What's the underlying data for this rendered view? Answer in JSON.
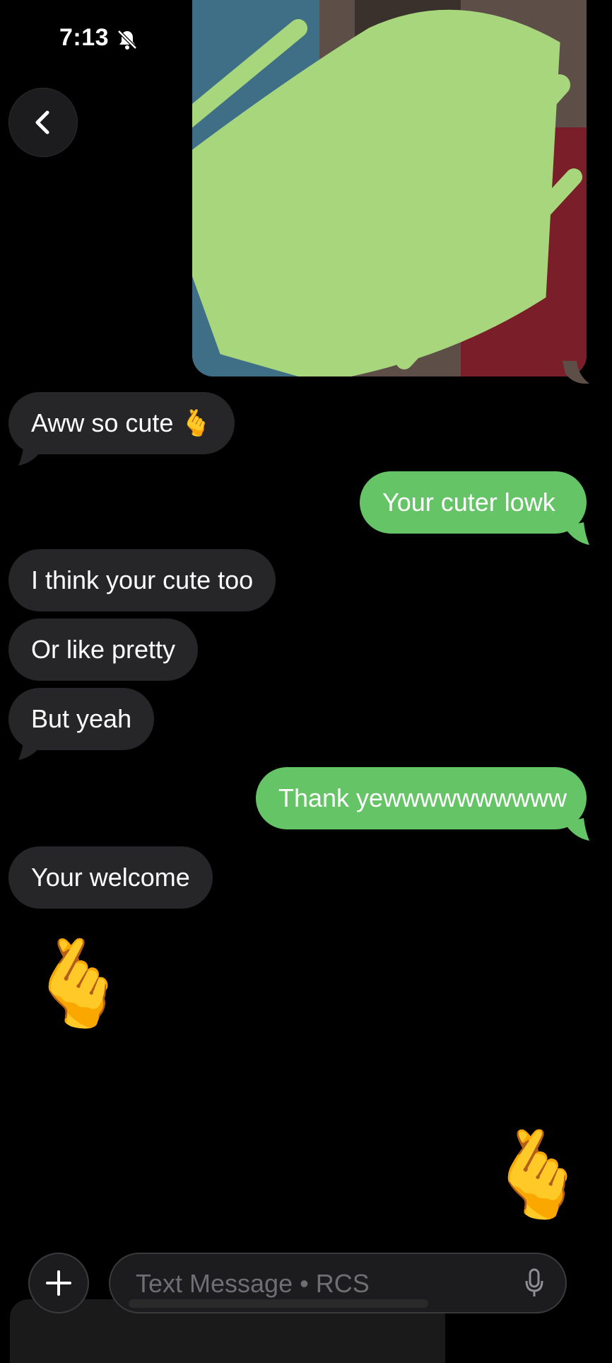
{
  "status_bar": {
    "time": "7:13"
  },
  "nav": {
    "back_icon": "chevron-left-icon"
  },
  "media": {
    "description_icon": "photo-redacted"
  },
  "messages": [
    {
      "dir": "in",
      "text": "Aww so cute 🫰"
    },
    {
      "dir": "out",
      "text": "Your cuter lowk"
    },
    {
      "dir": "in",
      "text": "I think your cute too"
    },
    {
      "dir": "in",
      "text": "Or like pretty"
    },
    {
      "dir": "in",
      "text": "But yeah"
    },
    {
      "dir": "out",
      "text": "Thank yewwwwwwwwww"
    },
    {
      "dir": "in",
      "text": "Your welcome"
    }
  ],
  "stickers": [
    {
      "dir": "in",
      "emoji": "🫰"
    },
    {
      "dir": "out",
      "emoji": "🫰"
    }
  ],
  "composer": {
    "placeholder": "Text Message • RCS",
    "plus_icon": "plus-icon",
    "mic_icon": "microphone-icon"
  },
  "colors": {
    "outgoing": "#65c466",
    "incoming": "#262628",
    "background": "#000000",
    "redaction": "#a8d67d"
  }
}
